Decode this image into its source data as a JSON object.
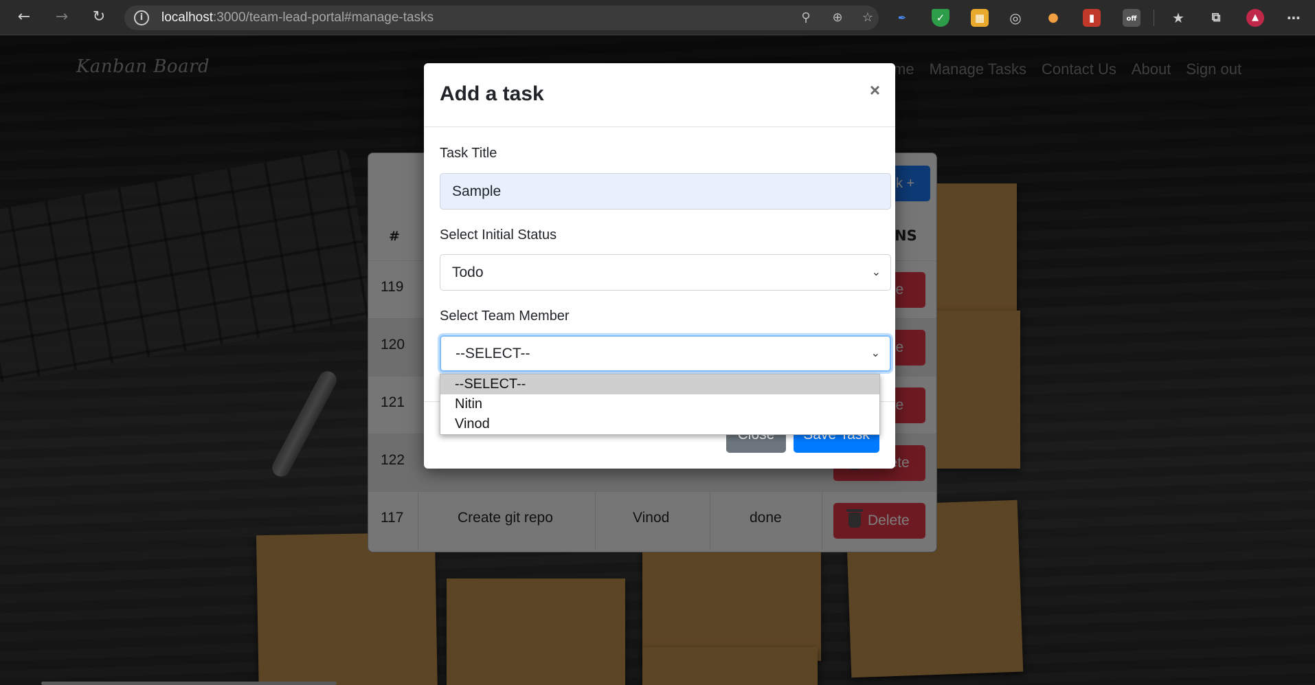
{
  "browser": {
    "url_host": "localhost",
    "url_path": ":3000/team-lead-portal#manage-tasks",
    "back_icon": "arrow-left-icon",
    "forward_icon": "arrow-right-icon",
    "refresh_icon": "refresh-icon"
  },
  "navbar": {
    "brand": "Kanban Board",
    "links": [
      "me",
      "Manage Tasks",
      "Contact Us",
      "About",
      "Sign out"
    ]
  },
  "table": {
    "add_button_partial": "k +",
    "header_hash": "#",
    "header_actions_partial": "NS",
    "rows": [
      {
        "id": "119",
        "title": "",
        "member": "",
        "status": "",
        "action": "ete"
      },
      {
        "id": "120",
        "title": "",
        "member": "",
        "status": "",
        "action": "ete"
      },
      {
        "id": "121",
        "title": "",
        "member": "",
        "status": "",
        "action": "ete"
      },
      {
        "id": "122",
        "title": "",
        "member": "",
        "status": "",
        "action": "Delete"
      },
      {
        "id": "117",
        "title": "Create git repo",
        "member": "Vinod",
        "status": "done",
        "action": "Delete"
      }
    ]
  },
  "modal": {
    "title": "Add a task",
    "close_symbol": "×",
    "task_title_label": "Task Title",
    "task_title_value": "Sample",
    "status_label": "Select Initial Status",
    "status_value": "Todo",
    "member_label": "Select Team Member",
    "member_value": "--SELECT--",
    "close_button": "Close",
    "save_button": "Save Task"
  },
  "member_options": [
    "--SELECT--",
    "Nitin",
    "Vinod"
  ],
  "colors": {
    "primary": "#007bff",
    "danger": "#dc3545",
    "secondary": "#6c757d"
  }
}
